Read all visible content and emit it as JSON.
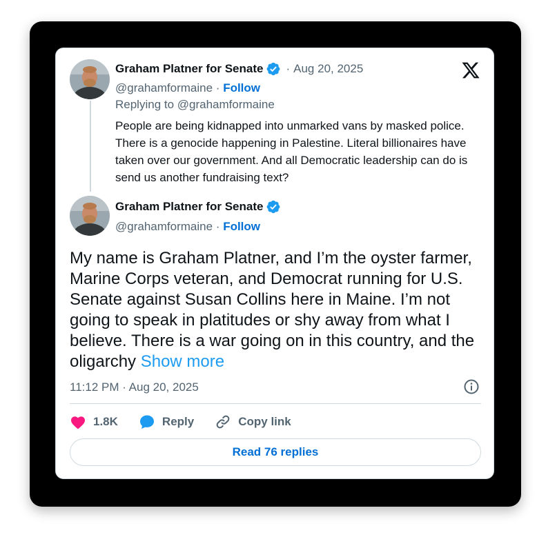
{
  "parent_tweet": {
    "author_name": "Graham Platner for Senate",
    "handle": "@grahamformaine",
    "follow_label": "Follow",
    "date": "Aug 20, 2025",
    "replying_to": "Replying to @grahamformaine",
    "text": "People are being kidnapped into unmarked vans by masked police. There is a genocide happening in Palestine. Literal billionaires have taken over our government. And all Democratic leadership can do is send us another fundraising text?"
  },
  "main_tweet": {
    "author_name": "Graham Platner for Senate",
    "handle": "@grahamformaine",
    "follow_label": "Follow",
    "text": "My name is Graham Platner, and I’m the oyster farmer, Marine Corps veteran, and Democrat running for U.S. Senate against Susan Collins here in Maine. I’m not going to speak in platitudes or shy away from what I believe. There is a war going on in this country, and the oligarchy ",
    "show_more_label": "Show more",
    "timestamp": "11:12 PM · Aug 20, 2025",
    "likes": "1.8K",
    "reply_label": "Reply",
    "copy_link_label": "Copy link",
    "read_replies_label": "Read 76 replies"
  },
  "separator": "·",
  "icons": {
    "brand": "x-logo-icon",
    "verified": "verified-badge-icon",
    "like": "heart-icon",
    "reply": "speech-bubble-icon",
    "copy": "link-icon",
    "info": "info-icon"
  },
  "colors": {
    "frame": "#000000",
    "card": "#ffffff",
    "text": "#0f1419",
    "muted": "#536471",
    "link": "#006fd6",
    "accent": "#1d9bf0",
    "heart": "#f91880",
    "border": "#cfd9de"
  }
}
